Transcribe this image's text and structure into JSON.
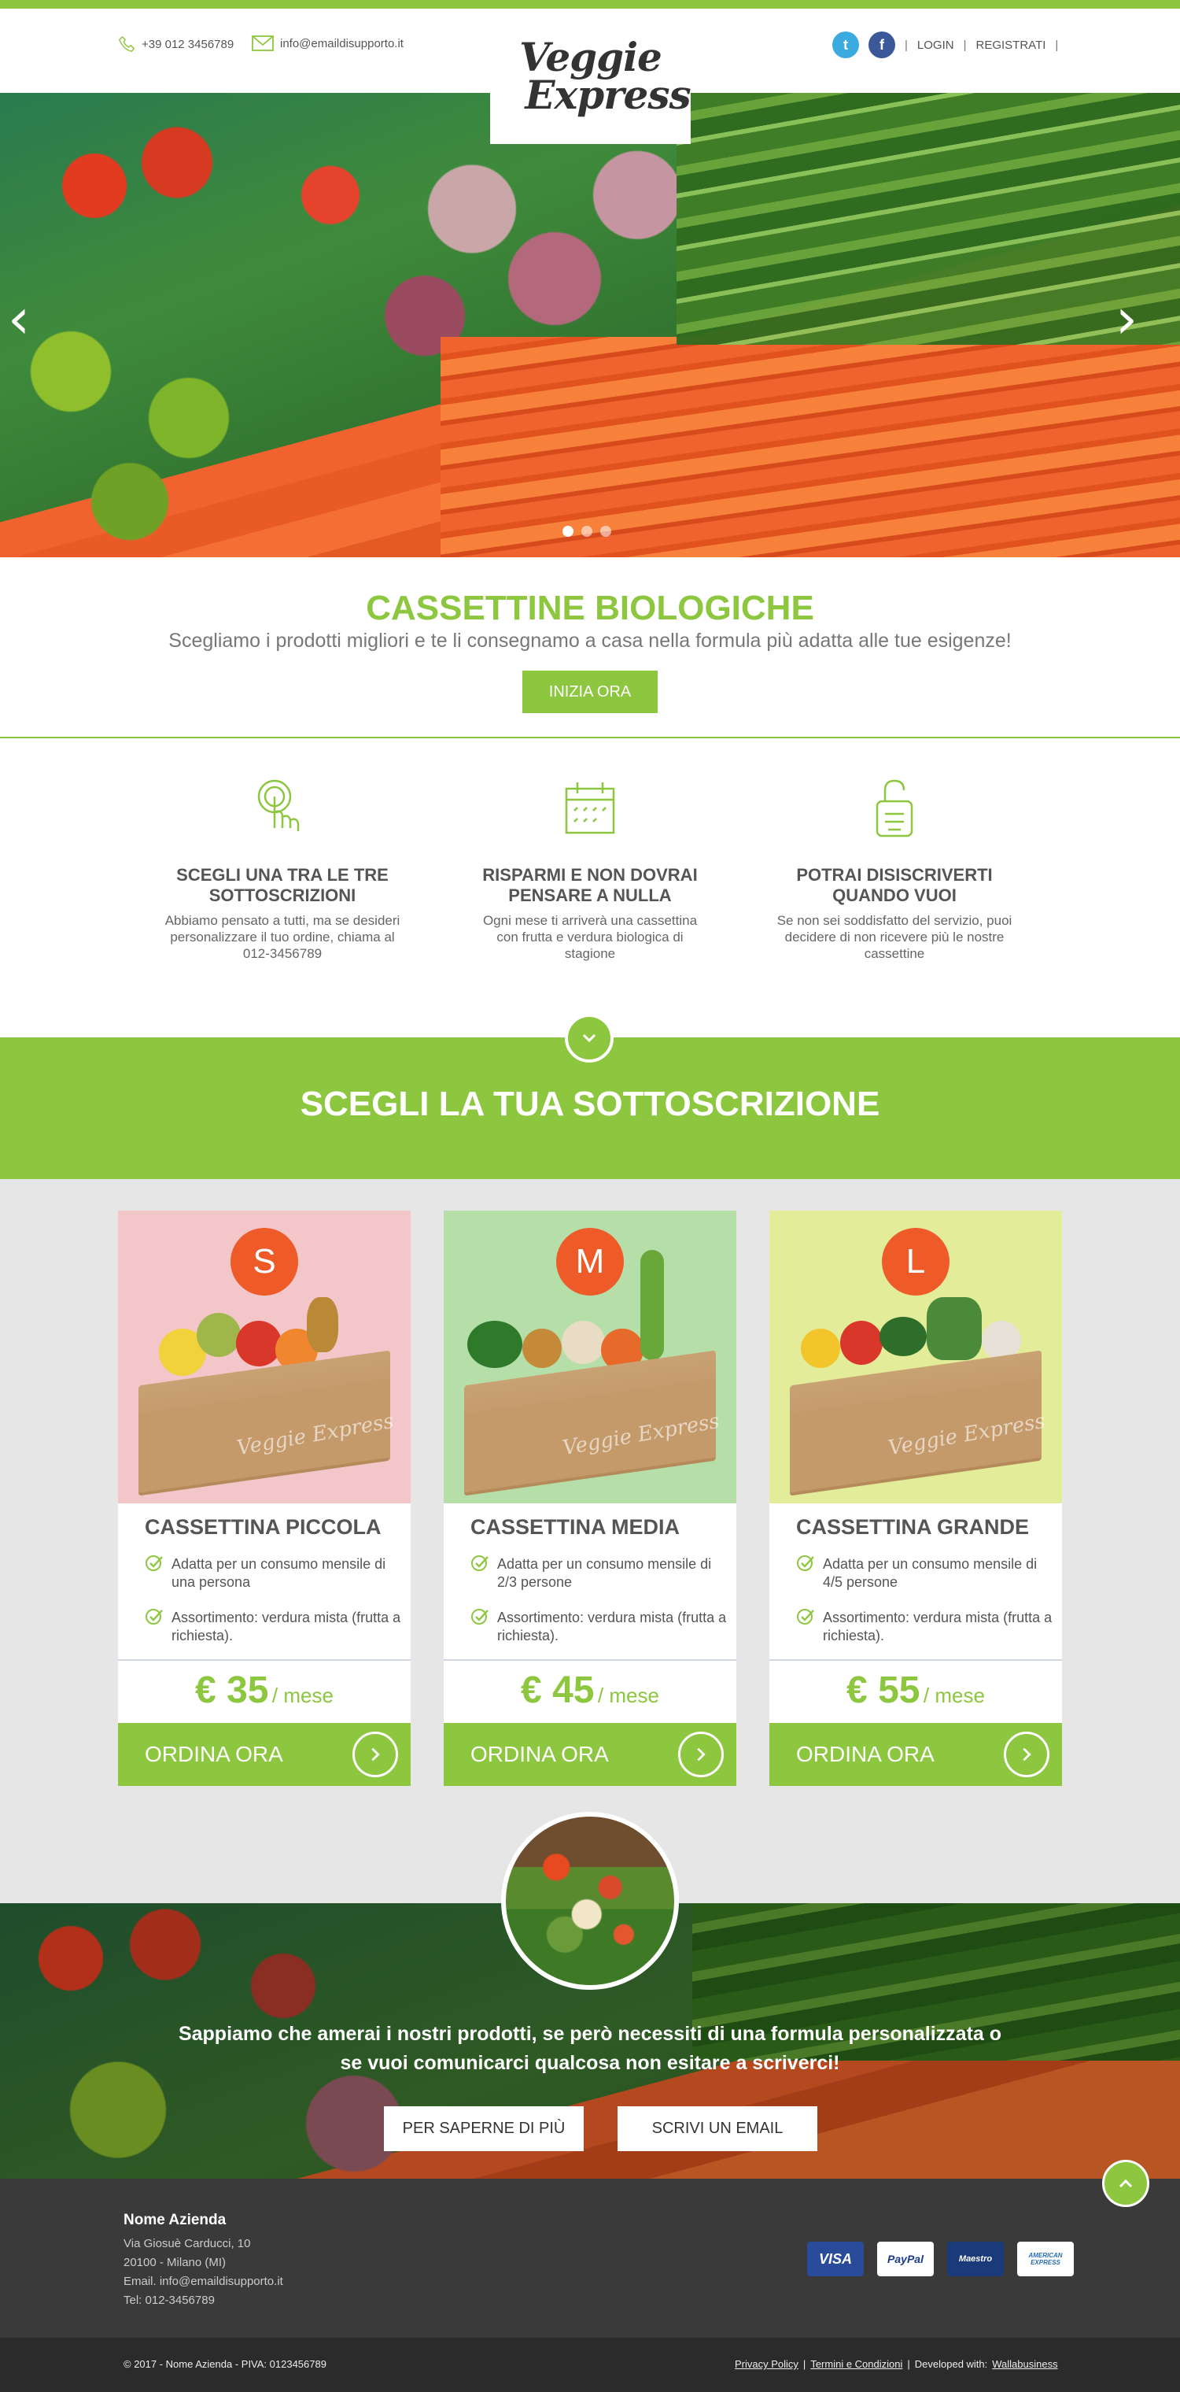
{
  "header": {
    "phone": "+39 012 3456789",
    "email": "info@emaildisupporto.it",
    "login": "LOGIN",
    "register": "REGISTRATI",
    "logo_line1": "Veggie",
    "logo_line2": "Express",
    "separator": "|"
  },
  "hero": {
    "prev_arrow": "‹",
    "next_arrow": "›",
    "slides": 3,
    "active_slide": 1
  },
  "intro": {
    "title": "CASSETTINE BIOLOGICHE",
    "subtitle": "Scegliamo i prodotti migliori e te li consegnamo a casa nella formula più adatta alle tue esigenze!",
    "cta": "INIZIA ORA"
  },
  "features": [
    {
      "icon": "touch-icon",
      "title": "SCEGLI UNA TRA LE TRE SOTTOSCRIZIONI",
      "text": "Abbiamo pensato a tutti, ma se desideri personalizzare il tuo ordine, chiama al 012-3456789"
    },
    {
      "icon": "calendar-icon",
      "title": "RISPARMI E NON DOVRAI PENSARE A NULLA",
      "text": "Ogni mese ti arriverà una cassettina con frutta e verdura biologica di stagione"
    },
    {
      "icon": "unlock-icon",
      "title": "POTRAI DISISCRIVERTI QUANDO VUOI",
      "text": "Se non sei soddisfatto del servizio, puoi decidere di non ricevere più le nostre cassettine"
    }
  ],
  "subscriptions": {
    "title": "SCEGLI LA TUA SOTTOSCRIZIONE",
    "plans": [
      {
        "badge": "S",
        "title": "CASSETTINA PICCOLA",
        "items": [
          "Adatta per un consumo mensile di una persona",
          "Assortimento: verdura mista (frutta a richiesta)."
        ],
        "price": "€ 35",
        "per": "/ mese",
        "order": "ORDINA ORA",
        "bg": "#f3c6c9"
      },
      {
        "badge": "M",
        "title": "CASSETTINA MEDIA",
        "items": [
          "Adatta per un consumo mensile di 2/3 persone",
          "Assortimento: verdura mista (frutta a richiesta)."
        ],
        "price": "€ 45",
        "per": "/ mese",
        "order": "ORDINA ORA",
        "bg": "#b5dea9"
      },
      {
        "badge": "L",
        "title": "CASSETTINA GRANDE",
        "items": [
          "Adatta per un consumo mensile di 4/5 persone",
          "Assortimento: verdura mista (frutta a richiesta)."
        ],
        "price": "€ 55",
        "per": "/ mese",
        "order": "ORDINA ORA",
        "bg": "#e2ec99"
      }
    ],
    "box_label": "Veggie Express"
  },
  "contact": {
    "text": "Sappiamo che amerai i nostri prodotti, se però necessiti di una formula personalizzata o se vuoi comunicarci qualcosa non esitare a scriverci!",
    "btn_more": "PER SAPERNE DI PIÙ",
    "btn_email": "SCRIVI UN EMAIL"
  },
  "footer": {
    "company": "Nome Azienda",
    "address1": "Via Giosuè Carducci, 10",
    "address2": "20100 - Milano (MI)",
    "email": "Email. info@emaildisupporto.it",
    "tel": "Tel: 012-3456789",
    "payments": [
      "VISA",
      "PayPal",
      "Maestro",
      "AMERICAN EXPRESS"
    ],
    "copyright": "© 2017 - Nome Azienda - PIVA: 0123456789",
    "privacy": "Privacy Policy",
    "terms": "Termini e Condizioni",
    "developed": "Developed with:",
    "developer": "Wallabusiness"
  },
  "colors": {
    "accent": "#8dc63f",
    "badge": "#ef5a29",
    "footer": "#3a3a3a",
    "footer_bottom": "#2b2b2b"
  }
}
